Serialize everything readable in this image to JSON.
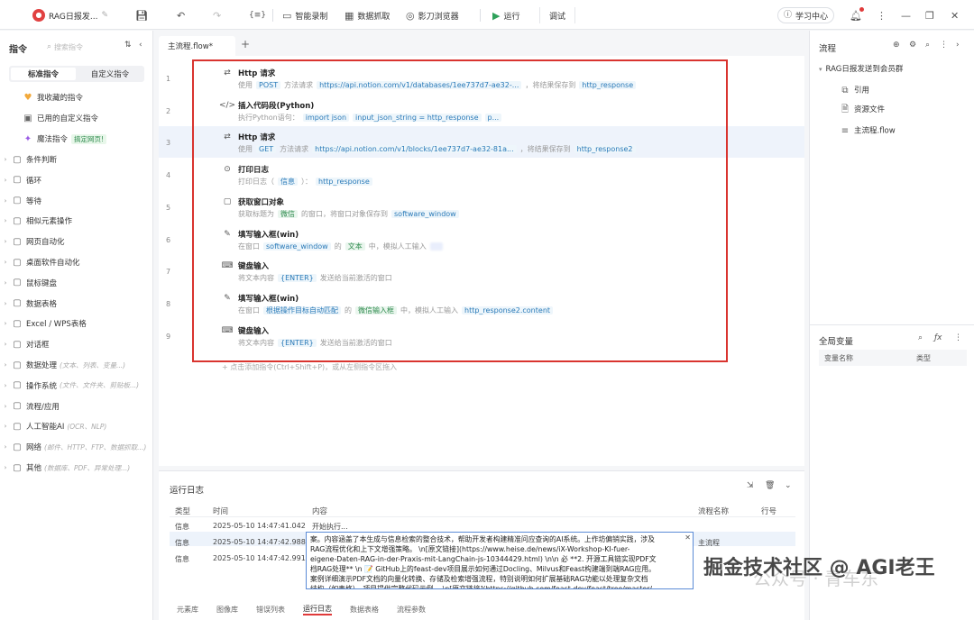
{
  "topbar": {
    "app_title": "RAG日报发...",
    "record": "智能录制",
    "grab": "数据抓取",
    "browser": "影刀浏览器",
    "run": "运行",
    "debug": "调试",
    "learn": "学习中心"
  },
  "left": {
    "title": "指令",
    "search_placeholder": "搜索指令",
    "tab_standard": "标准指令",
    "tab_custom": "自定义指令",
    "fav": "我收藏的指令",
    "used_custom": "已用的自定义指令",
    "magic": "魔法指令",
    "magic_badge": "搞定网页!",
    "categories": [
      {
        "label": "条件判断",
        "hint": ""
      },
      {
        "label": "循环",
        "hint": ""
      },
      {
        "label": "等待",
        "hint": ""
      },
      {
        "label": "相似元素操作",
        "hint": ""
      },
      {
        "label": "网页自动化",
        "hint": ""
      },
      {
        "label": "桌面软件自动化",
        "hint": ""
      },
      {
        "label": "鼠标键盘",
        "hint": ""
      },
      {
        "label": "数据表格",
        "hint": ""
      },
      {
        "label": "Excel / WPS表格",
        "hint": ""
      },
      {
        "label": "对话框",
        "hint": ""
      },
      {
        "label": "数据处理",
        "hint": "(文本、列表、变量...)"
      },
      {
        "label": "操作系统",
        "hint": "(文件、文件夹、剪贴板...)"
      },
      {
        "label": "流程/应用",
        "hint": ""
      },
      {
        "label": "人工智能AI",
        "hint": "(OCR、NLP)"
      },
      {
        "label": "网络",
        "hint": "(邮件、HTTP、FTP、数据抓取...)"
      },
      {
        "label": "其他",
        "hint": "(数据库、PDF、异常处理...)"
      }
    ]
  },
  "editor": {
    "tab": "主流程.flow*",
    "add_hint": "+ 点击添加指令(Ctrl+Shift+P)，或从左侧指令区拖入",
    "steps": [
      {
        "n": "1",
        "title": "Http 请求",
        "d1": "使用",
        "v1": "POST",
        "d2": "方法请求",
        "v2": "https://api.notion.com/v1/databases/1ee737d7-ae32-...",
        "d3": "，将结果保存到",
        "v3": "http_response"
      },
      {
        "n": "2",
        "title": "插入代码段(Python)",
        "d1": "执行Python语句：",
        "v1": "import json",
        "d2": "",
        "v2": "input_json_string = http_response",
        "d3": "",
        "v3": "p..."
      },
      {
        "n": "3",
        "title": "Http 请求",
        "d1": "使用",
        "v1": "GET",
        "d2": "方法请求",
        "v2": "https://api.notion.com/v1/blocks/1ee737d7-ae32-81a...",
        "d3": "，将结果保存到",
        "v3": "http_response2"
      },
      {
        "n": "4",
        "title": "打印日志",
        "d1": "打印日志（",
        "v1": "信息",
        "d2": "）：",
        "v2": "http_response",
        "d3": "",
        "v3": ""
      },
      {
        "n": "5",
        "title": "获取窗口对象",
        "d1": "获取标题为",
        "v1": "微信",
        "d2": "的窗口，将窗口对象保存到",
        "v2": "software_window",
        "d3": "",
        "v3": ""
      },
      {
        "n": "6",
        "title": "填写输入框(win)",
        "d1": "在窗口",
        "v1": "software_window",
        "d2": "的",
        "v2": "文本",
        "d3": "中，模拟人工输入",
        "v3": "xxx"
      },
      {
        "n": "7",
        "title": "键盘输入",
        "d1": "将文本内容",
        "v1": "{ENTER}",
        "d2": "发送给当前激活的窗口",
        "v2": "",
        "d3": "",
        "v3": ""
      },
      {
        "n": "8",
        "title": "填写输入框(win)",
        "d1": "在窗口",
        "v1": "根据操作目标自动匹配",
        "d2": "的",
        "v2": "微信输入框",
        "d3": "中，模拟人工输入",
        "v3": "http_response2.content"
      },
      {
        "n": "9",
        "title": "键盘输入",
        "d1": "将文本内容",
        "v1": "{ENTER}",
        "d2": "发送给当前激活的窗口",
        "v2": "",
        "d3": "",
        "v3": ""
      }
    ]
  },
  "log": {
    "title": "运行日志",
    "headers": [
      "类型",
      "时间",
      "内容",
      "流程名称",
      "行号"
    ],
    "rows": [
      {
        "type": "信息",
        "time": "2025-05-10 14:47:41.042",
        "content": "开始执行...",
        "flow": "",
        "line": ""
      },
      {
        "type": "信息",
        "time": "2025-05-10 14:47:42.988",
        "content": "",
        "flow": "主流程",
        "line": ""
      },
      {
        "type": "信息",
        "time": "2025-05-10 14:47:42.991",
        "content": "",
        "flow": "",
        "line": ""
      }
    ],
    "bubble_lines": [
      "案。内容涵盖了本生成与信息检索的整合技术，帮助开发者构建精准问应查询的AI系统。上作坊偏销实践，涉及",
      "RAG流程优化和上下文增强策略。 \\n[原文链接](https://www.heise.de/news/iX-Workshop-KI-fuer-",
      "eigene-Daten-RAG-in-der-Praxis-mit-LangChain-js-10344429.html)  \\n\\n 必 **2. 开源工具链实现PDF文",
      "档RAG处理** \\n 📝 GitHub上的feast-dev项目展示如何通过Docling、Milvus和Feast构建端到端RAG应用。",
      "案例详细演示PDF文档的向量化转换、存储及检索增强流程，特别说明如何扩展基础RAG功能以处理复杂文档",
      "结构（如表格）。项目提供完整代码示例。 \\n[原文链接](https://github.com/feast-dev/feast/tree/master/"
    ],
    "bottom_tabs": [
      "元素库",
      "图像库",
      "错误列表",
      "运行日志",
      "数据表格",
      "流程参数"
    ]
  },
  "right": {
    "flow_title": "流程",
    "tree_root": "RAG日报发送到会员群",
    "tree_items": [
      "引用",
      "资源文件",
      "主流程.flow"
    ],
    "globals_title": "全局变量",
    "col_name": "变量名称",
    "col_type": "类型"
  },
  "watermark": {
    "main": "掘金技术社区 @ AGI老王",
    "sub": "公众号 · 青车东"
  }
}
